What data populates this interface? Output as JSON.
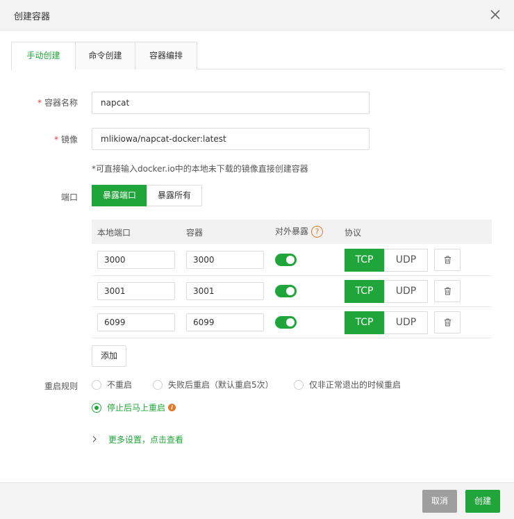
{
  "dialog": {
    "title": "创建容器"
  },
  "tabs": [
    {
      "label": "手动创建",
      "active": true
    },
    {
      "label": "命令创建",
      "active": false
    },
    {
      "label": "容器编排",
      "active": false
    }
  ],
  "form": {
    "name_label": "容器名称",
    "name_value": "napcat",
    "image_label": "镜像",
    "image_value": "mlikiowa/napcat-docker:latest",
    "image_hint": "*可直接输入docker.io中的本地未下载的镜像直接创建容器",
    "required_mark": "*",
    "ports_label": "端口",
    "port_mode_options": [
      {
        "label": "暴露端口",
        "selected": true
      },
      {
        "label": "暴露所有",
        "selected": false
      }
    ],
    "port_table": {
      "headers": {
        "local": "本地端口",
        "container": "容器",
        "expose": "对外暴露",
        "protocol": "协议"
      },
      "help_icon": "?",
      "rows": [
        {
          "local": "3000",
          "container": "3000",
          "expose": true,
          "protocol": "TCP"
        },
        {
          "local": "3001",
          "container": "3001",
          "expose": true,
          "protocol": "TCP"
        },
        {
          "local": "6099",
          "container": "6099",
          "expose": true,
          "protocol": "TCP"
        }
      ],
      "protocol_options": [
        "TCP",
        "UDP"
      ]
    },
    "add_label": "添加",
    "restart_label": "重启规则",
    "restart_options": [
      {
        "label": "不重启",
        "checked": false
      },
      {
        "label": "失败后重启（默认重启5次）",
        "checked": false
      },
      {
        "label": "仅非正常退出的时候重启",
        "checked": false
      },
      {
        "label": "停止后马上重启",
        "checked": true
      }
    ],
    "more_settings": "更多设置，点击查看"
  },
  "footer": {
    "cancel": "取消",
    "create": "创建"
  },
  "colors": {
    "accent": "#20a53a",
    "cancel": "#9e9e9e",
    "warning": "#e07b2a",
    "required": "#e53935"
  }
}
